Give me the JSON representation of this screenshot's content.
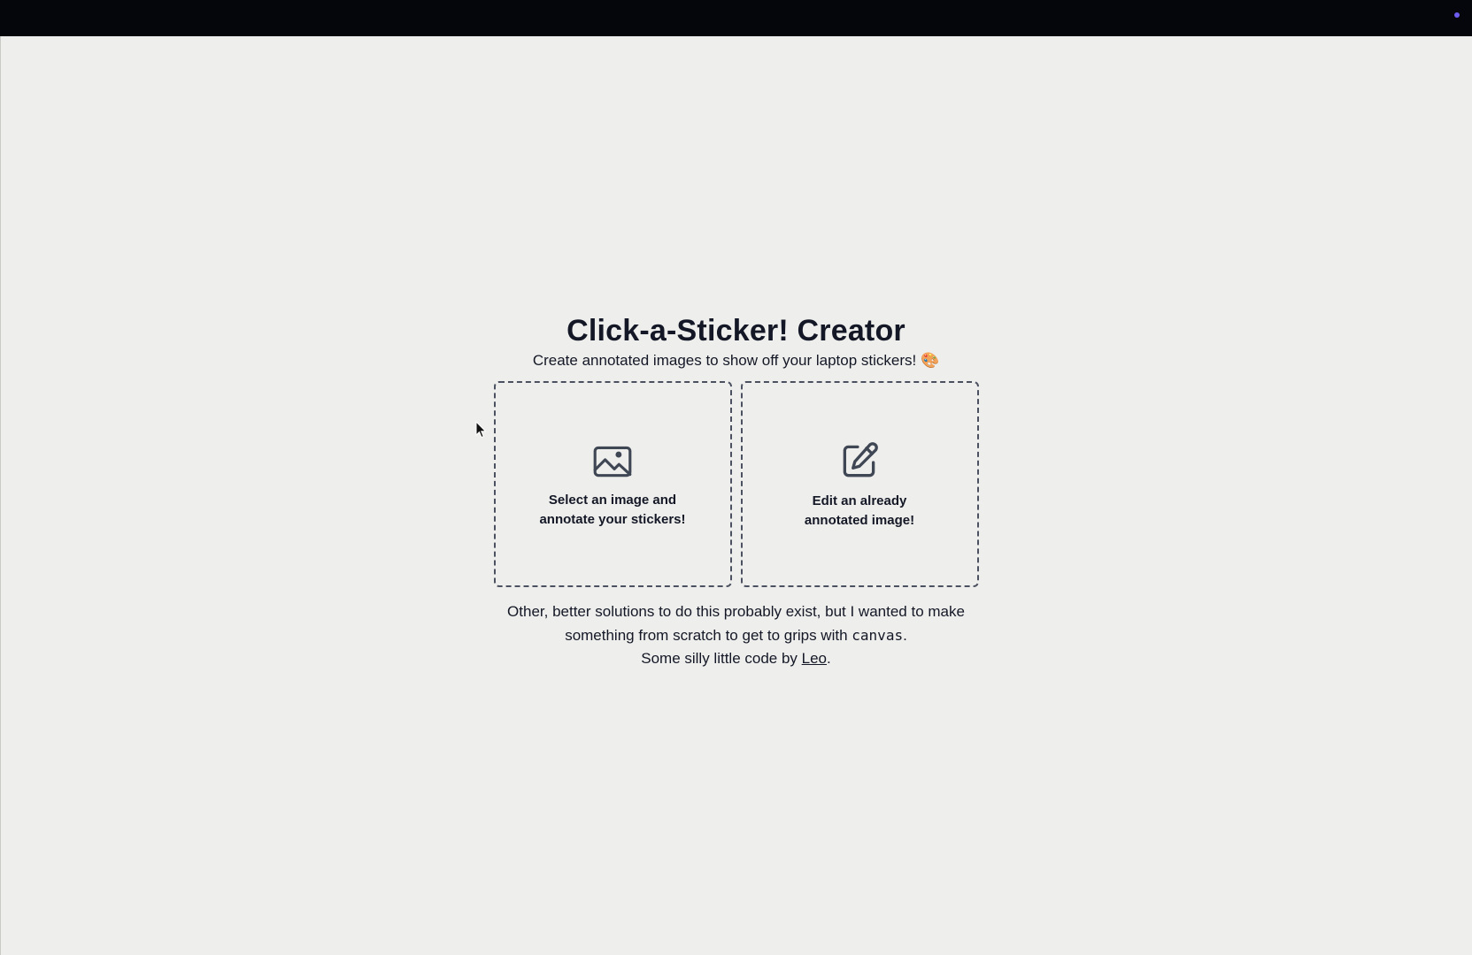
{
  "header": {
    "title": "Click-a-Sticker! Creator",
    "subtitle": "Create annotated images to show off your laptop stickers! 🎨"
  },
  "cards": [
    {
      "icon": "image-icon",
      "label": "Select an image and annotate your stickers!"
    },
    {
      "icon": "edit-icon",
      "label": "Edit an already annotated image!"
    }
  ],
  "footer": {
    "line1": "Other, better solutions to do this probably exist, but I wanted to make",
    "line2_before": "something from scratch to get to grips with ",
    "line2_code": "canvas",
    "line2_after": ".",
    "line3_before": "Some silly little code by ",
    "author_link": "Leo",
    "line3_after": "."
  },
  "colors": {
    "background": "#eeeeec",
    "top_bar": "#05060b",
    "accent_dot": "#6d5cf0",
    "text": "#141826",
    "card_border": "#4b5160"
  }
}
